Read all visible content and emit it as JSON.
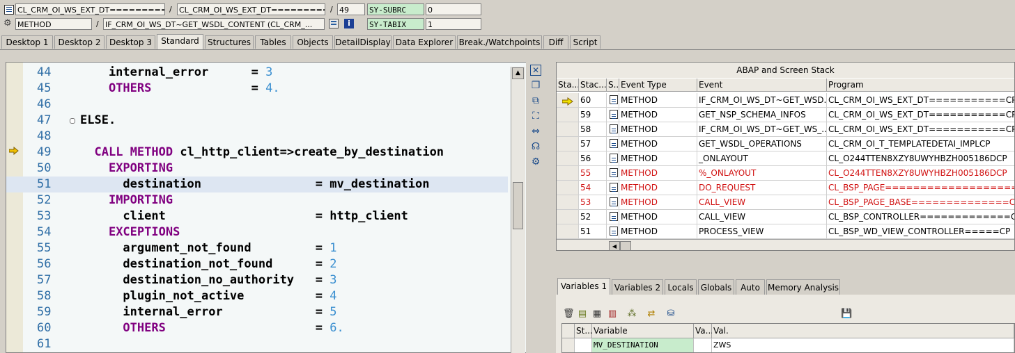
{
  "header": {
    "row1": {
      "program_field": "CL_CRM_OI_WS_EXT_DT===========...",
      "separator": "/",
      "include_field": "CL_CRM_OI_WS_EXT_DT==========...",
      "line_field": "49",
      "sysfield_name": "SY-SUBRC",
      "sysfield_value": "0"
    },
    "row2": {
      "type_field": "METHOD",
      "separator": "/",
      "method_field": "IF_CRM_OI_WS_DT~GET_WSDL_CONTENT (CL_CRM_...",
      "sysfield_name": "SY-TABIX",
      "sysfield_value": "1"
    }
  },
  "tabs": [
    {
      "label": "Desktop 1"
    },
    {
      "label": "Desktop 2"
    },
    {
      "label": "Desktop 3"
    },
    {
      "label": "Standard"
    },
    {
      "label": "Structures"
    },
    {
      "label": "Tables"
    },
    {
      "label": "Objects"
    },
    {
      "label": "DetailDisplay"
    },
    {
      "label": "Data Explorer"
    },
    {
      "label": "Break./Watchpoints"
    },
    {
      "label": "Diff"
    },
    {
      "label": "Script"
    }
  ],
  "code": {
    "lines": [
      {
        "n": "44",
        "t": "    internal_error      = 3"
      },
      {
        "n": "45",
        "t": "    OTHERS              = 4."
      },
      {
        "n": "46",
        "t": ""
      },
      {
        "n": "47",
        "t": "ELSE."
      },
      {
        "n": "48",
        "t": ""
      },
      {
        "n": "49",
        "t": "  CALL METHOD cl_http_client=>create_by_destination"
      },
      {
        "n": "50",
        "t": "    EXPORTING"
      },
      {
        "n": "51",
        "t": "      destination                = mv_destination"
      },
      {
        "n": "52",
        "t": "    IMPORTING"
      },
      {
        "n": "53",
        "t": "      client                     = http_client"
      },
      {
        "n": "54",
        "t": "    EXCEPTIONS"
      },
      {
        "n": "55",
        "t": "      argument_not_found         = 1"
      },
      {
        "n": "56",
        "t": "      destination_not_found      = 2"
      },
      {
        "n": "57",
        "t": "      destination_no_authority   = 3"
      },
      {
        "n": "58",
        "t": "      plugin_not_active          = 4"
      },
      {
        "n": "59",
        "t": "      internal_error             = 5"
      },
      {
        "n": "60",
        "t": "      OTHERS                     = 6."
      },
      {
        "n": "61",
        "t": ""
      }
    ]
  },
  "stack": {
    "title": "ABAP and Screen Stack",
    "columns": [
      "Sta...",
      "Stac...",
      "S...",
      "Event Type",
      "Event",
      "Program"
    ],
    "rows": [
      {
        "level": "60",
        "type": "METHOD",
        "event": "IF_CRM_OI_WS_DT~GET_WSD...",
        "program": "CL_CRM_OI_WS_EXT_DT===========CP",
        "red": false,
        "current": true
      },
      {
        "level": "59",
        "type": "METHOD",
        "event": "GET_NSP_SCHEMA_INFOS",
        "program": "CL_CRM_OI_WS_EXT_DT===========CP",
        "red": false,
        "current": false
      },
      {
        "level": "58",
        "type": "METHOD",
        "event": "IF_CRM_OI_WS_DT~GET_WS_...",
        "program": "CL_CRM_OI_WS_EXT_DT===========CP",
        "red": false,
        "current": false
      },
      {
        "level": "57",
        "type": "METHOD",
        "event": "GET_WSDL_OPERATIONS",
        "program": "CL_CRM_OI_T_TEMPLATEDETAI_IMPLCP",
        "red": false,
        "current": false
      },
      {
        "level": "56",
        "type": "METHOD",
        "event": "_ONLAYOUT",
        "program": "CL_O244TTEN8XZY8UWYHBZH005186DCP",
        "red": false,
        "current": false
      },
      {
        "level": "55",
        "type": "METHOD",
        "event": "%_ONLAYOUT",
        "program": "CL_O244TTEN8XZY8UWYHBZH005186DCP",
        "red": true,
        "current": false
      },
      {
        "level": "54",
        "type": "METHOD",
        "event": "DO_REQUEST",
        "program": "CL_BSP_PAGE===================CP",
        "red": true,
        "current": false
      },
      {
        "level": "53",
        "type": "METHOD",
        "event": "CALL_VIEW",
        "program": "CL_BSP_PAGE_BASE==============CP",
        "red": true,
        "current": false
      },
      {
        "level": "52",
        "type": "METHOD",
        "event": "CALL_VIEW",
        "program": "CL_BSP_CONTROLLER=============CP",
        "red": false,
        "current": false
      },
      {
        "level": "51",
        "type": "METHOD",
        "event": "PROCESS_VIEW",
        "program": "CL_BSP_WD_VIEW_CONTROLLER=====CP",
        "red": false,
        "current": false
      }
    ]
  },
  "variables": {
    "tabs": [
      {
        "label": "Variables 1"
      },
      {
        "label": "Variables 2"
      },
      {
        "label": "Locals"
      },
      {
        "label": "Globals"
      },
      {
        "label": "Auto"
      },
      {
        "label": "Memory Analysis"
      }
    ],
    "columns": [
      "St...",
      "Variable",
      "Va...",
      "Val."
    ],
    "rows": [
      {
        "variable": "MV_DESTINATION",
        "value": "ZWS"
      }
    ]
  },
  "colors": {
    "keyword": "#800080",
    "number": "#3a8fd0",
    "line_number": "#2f6ea6",
    "error_red": "#d01010",
    "field_green": "#c8eccc"
  }
}
